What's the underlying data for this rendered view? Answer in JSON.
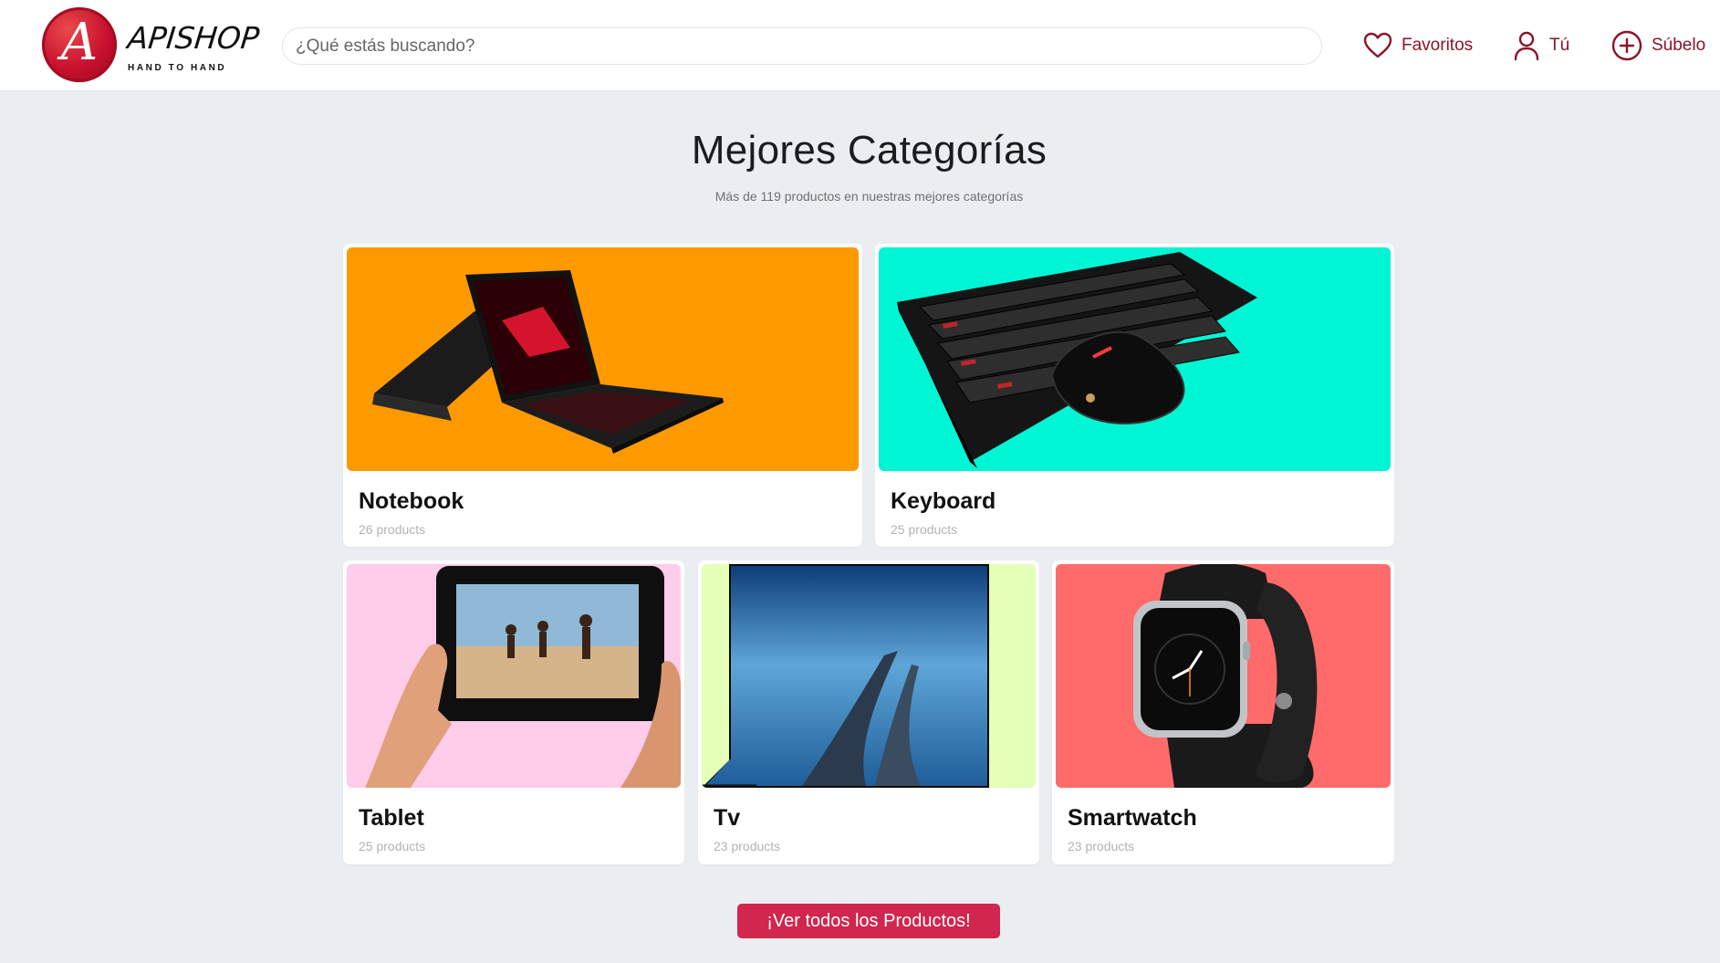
{
  "header": {
    "logo": {
      "letter": "A",
      "word": "APISHOP",
      "tagline": "HAND TO HAND"
    },
    "search": {
      "placeholder": "¿Qué estás buscando?"
    },
    "nav": {
      "favorites": {
        "label": "Favoritos",
        "icon": "heart-icon"
      },
      "you": {
        "label": "Tú",
        "icon": "user-icon"
      },
      "upload": {
        "label": "Súbelo",
        "icon": "plus-circle-icon"
      }
    }
  },
  "main": {
    "title": "Mejores Categorías",
    "subtitle": "Más de 119 productos en nuestras mejores categorías",
    "categories": [
      {
        "name": "Notebook",
        "count": "26 products",
        "bg": "#ff9900"
      },
      {
        "name": "Keyboard",
        "count": "25 products",
        "bg": "#00f5d4"
      },
      {
        "name": "Tablet",
        "count": "25 products",
        "bg": "#ffccea"
      },
      {
        "name": "Tv",
        "count": "23 products",
        "bg": "#e4ffb7"
      },
      {
        "name": "Smartwatch",
        "count": "23 products",
        "bg": "#ff6b6b"
      }
    ],
    "cta_label": "¡Ver todos los Productos!"
  },
  "colors": {
    "brand": "#8b1329",
    "cta": "#d1264e",
    "page_bg": "#ebeef1"
  }
}
